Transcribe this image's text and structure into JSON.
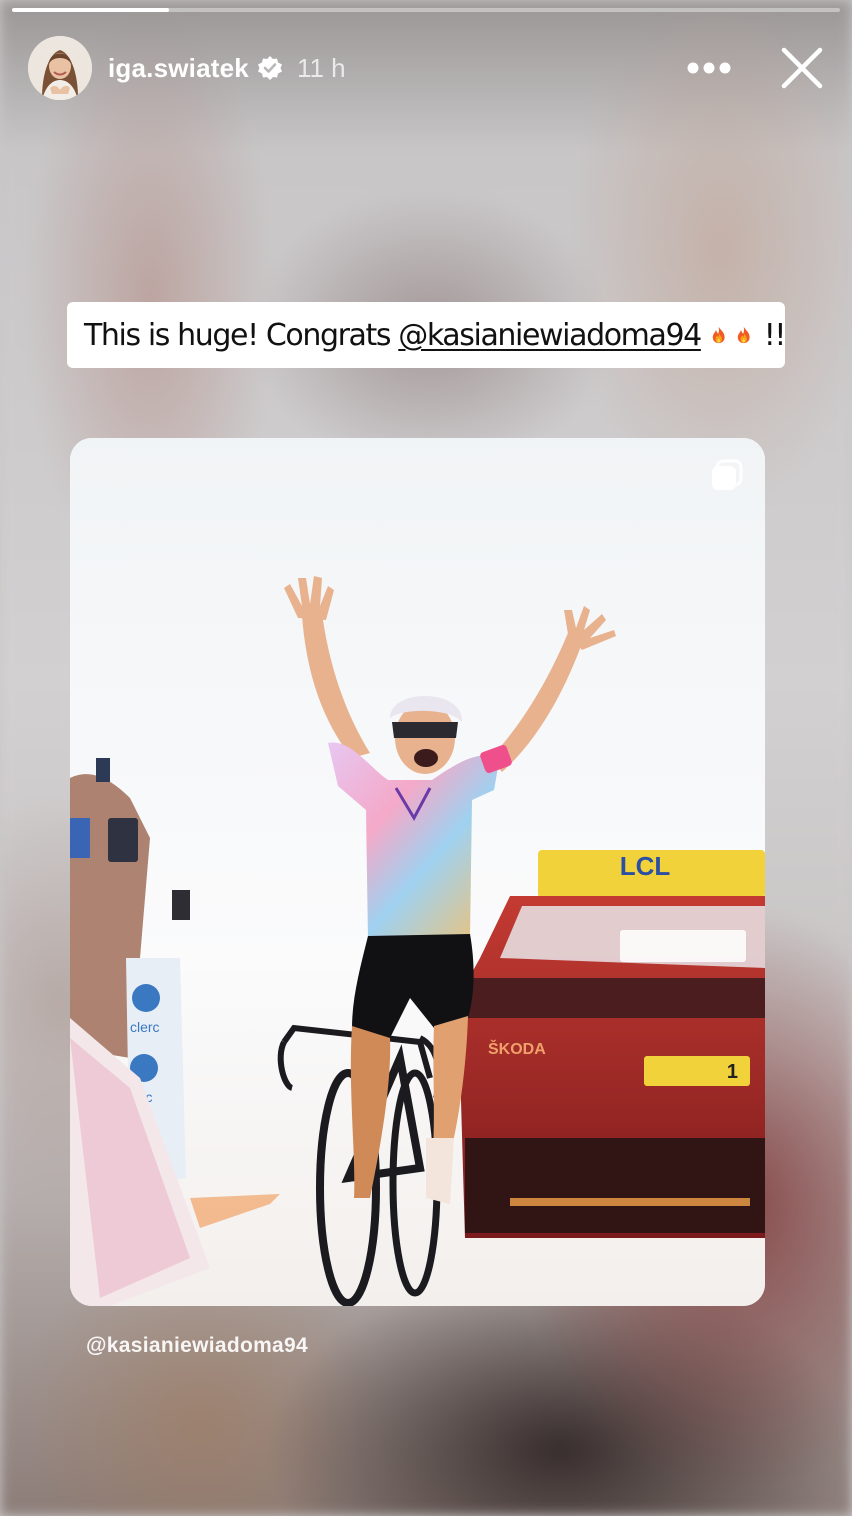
{
  "story": {
    "progress": 0.19,
    "colors": {
      "progress_fill": "#ffffff",
      "text": "#ffffff",
      "caption_bg": "#ffffff",
      "caption_text": "#111111"
    }
  },
  "header": {
    "username": "iga.swiatek",
    "verified": true,
    "time": "11 h",
    "more_icon": "more-horizontal-icon",
    "close_icon": "close-icon"
  },
  "caption": {
    "prefix": "This is huge! Congrats ",
    "mention": "@kasianiewiadoma94",
    "emojis": [
      "fire-emoji",
      "fire-emoji"
    ],
    "suffix": "!!"
  },
  "post": {
    "media_icon": "multiple-photos-icon",
    "author": "@kasianiewiadoma94",
    "photo_text": {
      "car_roof": "LCL",
      "car_brand": "ŠKODA",
      "car_plate": "1",
      "banner_left": "clerc",
      "banner_left_2": "lerc"
    }
  }
}
